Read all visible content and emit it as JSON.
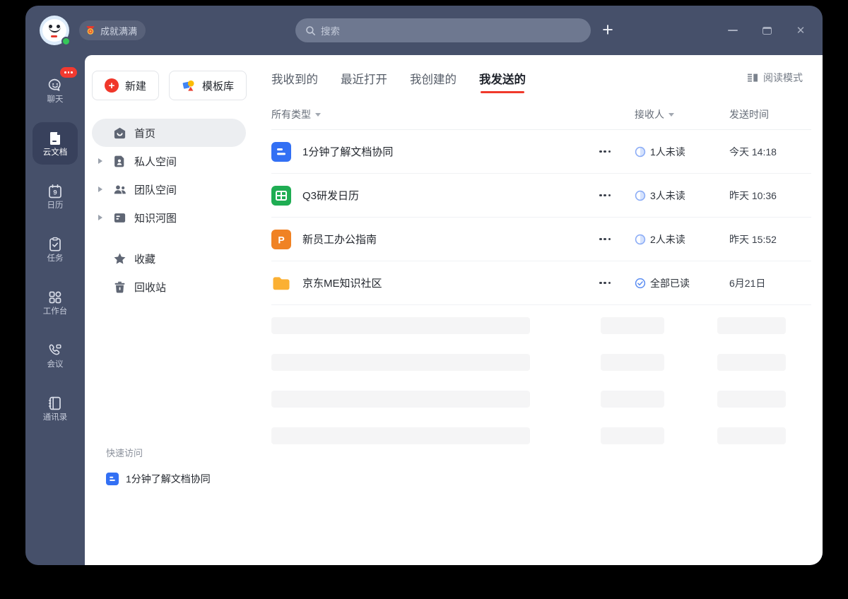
{
  "window": {
    "badge": {
      "label": "成就满满",
      "icon": "medal-icon"
    },
    "search": {
      "placeholder": "搜索",
      "icon": "search-icon"
    },
    "actions": {
      "new_icon": "plus-icon"
    },
    "controls": {
      "minimize": "minimize-icon",
      "maximize": "maximize-icon",
      "close": "close-icon"
    }
  },
  "rail": {
    "items": [
      {
        "label": "聊天",
        "icon": "chat-icon",
        "badge": "•••"
      },
      {
        "label": "云文档",
        "icon": "cloud-docs-icon",
        "active": true
      },
      {
        "label": "日历",
        "icon": "calendar-icon",
        "day": "9"
      },
      {
        "label": "任务",
        "icon": "tasks-icon"
      },
      {
        "label": "工作台",
        "icon": "workbench-icon"
      },
      {
        "label": "会议",
        "icon": "meeting-icon"
      },
      {
        "label": "通讯录",
        "icon": "contacts-icon"
      }
    ]
  },
  "panel": {
    "new_button": "新建",
    "template_button": "模板库",
    "template_icon": "template-library-icon",
    "nav": [
      {
        "label": "首页",
        "icon": "home-icon",
        "active": true
      },
      {
        "label": "私人空间",
        "icon": "personal-space-icon",
        "expandable": true
      },
      {
        "label": "团队空间",
        "icon": "team-space-icon",
        "expandable": true
      },
      {
        "label": "知识河图",
        "icon": "knowledge-map-icon",
        "expandable": true
      },
      {
        "label": "收藏",
        "icon": "star-icon"
      },
      {
        "label": "回收站",
        "icon": "trash-icon"
      }
    ],
    "quick_access": {
      "title": "快速访问",
      "items": [
        {
          "label": "1分钟了解文档协同",
          "icon": "doc-blue-icon"
        }
      ]
    }
  },
  "main": {
    "tabs": [
      {
        "label": "我收到的"
      },
      {
        "label": "最近打开"
      },
      {
        "label": "我创建的"
      },
      {
        "label": "我发送的",
        "active": true
      }
    ],
    "read_mode": "阅读模式",
    "read_mode_icon": "read-mode-icon",
    "columns": {
      "type": "所有类型",
      "receiver": "接收人",
      "sent_time": "发送时间"
    },
    "rows": [
      {
        "title": "1分钟了解文档协同",
        "icon": "doc-blue-icon",
        "more_icon": "more-menu-icon",
        "status_icon": "unread-ring-icon",
        "status": "1人未读",
        "time": "今天 14:18"
      },
      {
        "title": "Q3研发日历",
        "icon": "sheet-green-icon",
        "more_icon": "more-menu-icon",
        "status_icon": "unread-ring-icon",
        "status": "3人未读",
        "time": "昨天 10:36"
      },
      {
        "title": "新员工办公指南",
        "icon": "slides-orange-icon",
        "icon_letter": "P",
        "more_icon": "more-menu-icon",
        "status_icon": "unread-ring-icon",
        "status": "2人未读",
        "time": "昨天 15:52"
      },
      {
        "title": "京东ME知识社区",
        "icon": "folder-icon",
        "more_icon": "more-menu-icon",
        "status_icon": "all-read-check-icon",
        "status": "全部已读",
        "time": "6月21日"
      }
    ],
    "skeleton_rows": 4
  },
  "colors": {
    "window_navy": "#46506A",
    "rail_selected": "#38415C",
    "accent_red": "#F0392B",
    "doc_blue": "#3370F4",
    "sheet_green": "#1FAD53",
    "slides_orange": "#F08224",
    "folder_yellow": "#FBB033",
    "status_blue": "#5B8DF2",
    "skeleton_gray": "#F5F5F6",
    "presence_green": "#35C759"
  }
}
